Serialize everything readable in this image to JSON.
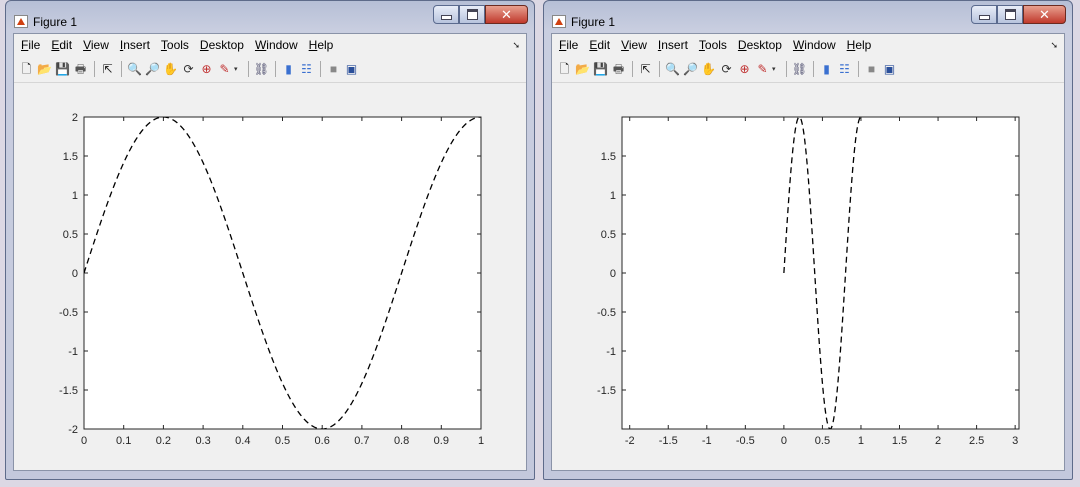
{
  "windows": [
    {
      "title": "Figure 1",
      "menu": [
        "File",
        "Edit",
        "View",
        "Insert",
        "Tools",
        "Desktop",
        "Window",
        "Help"
      ],
      "menu_accels": [
        "F",
        "E",
        "V",
        "I",
        "T",
        "D",
        "W",
        "H"
      ],
      "toolbar_icons": [
        "new-figure-icon",
        "open-file-icon",
        "save-icon",
        "print-icon",
        "|",
        "pointer-icon",
        "|",
        "zoom-in-icon",
        "zoom-out-icon",
        "pan-icon",
        "rotate-icon",
        "data-cursor-icon",
        "brush-icon",
        "brush-dropdown-icon",
        "|",
        "link-plot-icon",
        "|",
        "colorbar-icon",
        "legend-icon",
        "|",
        "hide-tools-icon",
        "show-tools-icon"
      ]
    },
    {
      "title": "Figure 1",
      "menu": [
        "File",
        "Edit",
        "View",
        "Insert",
        "Tools",
        "Desktop",
        "Window",
        "Help"
      ],
      "menu_accels": [
        "F",
        "E",
        "V",
        "I",
        "T",
        "D",
        "W",
        "H"
      ],
      "toolbar_icons": [
        "new-figure-icon",
        "open-file-icon",
        "save-icon",
        "print-icon",
        "|",
        "pointer-icon",
        "|",
        "zoom-in-icon",
        "zoom-out-icon",
        "pan-icon",
        "rotate-icon",
        "data-cursor-icon",
        "brush-icon",
        "brush-dropdown-icon",
        "|",
        "link-plot-icon",
        "|",
        "colorbar-icon",
        "legend-icon",
        "|",
        "hide-tools-icon",
        "show-tools-icon"
      ]
    }
  ],
  "chart_data": [
    {
      "type": "line",
      "series_style": "dashed",
      "line_color": "#000000",
      "function": "y = 2*sin(2.5*pi*x)",
      "x": [
        0,
        0.05,
        0.1,
        0.15,
        0.2,
        0.25,
        0.3,
        0.35,
        0.4,
        0.45,
        0.5,
        0.55,
        0.6,
        0.65,
        0.7,
        0.75,
        0.8,
        0.85,
        0.9,
        0.95,
        1.0
      ],
      "y": [
        0,
        0.765,
        1.414,
        1.848,
        2.0,
        1.848,
        1.414,
        0.765,
        0,
        -0.765,
        -1.414,
        -1.848,
        -2.0,
        -1.848,
        -1.414,
        -0.765,
        0,
        0.765,
        1.414,
        1.848,
        2.0
      ],
      "xlim": [
        0,
        1
      ],
      "ylim": [
        -2,
        2
      ],
      "xticks": [
        "0",
        "0.1",
        "0.2",
        "0.3",
        "0.4",
        "0.5",
        "0.6",
        "0.7",
        "0.8",
        "0.9",
        "1"
      ],
      "yticks": [
        "-2",
        "-1.5",
        "-1",
        "-0.5",
        "0",
        "0.5",
        "1",
        "1.5",
        "2"
      ],
      "xtick_values": [
        0,
        0.1,
        0.2,
        0.3,
        0.4,
        0.5,
        0.6,
        0.7,
        0.8,
        0.9,
        1
      ],
      "ytick_values": [
        -2,
        -1.5,
        -1,
        -0.5,
        0,
        0.5,
        1,
        1.5,
        2
      ],
      "title": "",
      "xlabel": "",
      "ylabel": "",
      "grid": false
    },
    {
      "type": "line",
      "series_style": "dashed",
      "line_color": "#000000",
      "function": "y = 2*sin(2.5*pi*x)",
      "x": [
        0,
        0.05,
        0.1,
        0.15,
        0.2,
        0.25,
        0.3,
        0.35,
        0.4,
        0.45,
        0.5,
        0.55,
        0.6,
        0.65,
        0.7,
        0.75,
        0.8,
        0.85,
        0.9,
        0.95,
        1.0
      ],
      "y": [
        0,
        0.765,
        1.414,
        1.848,
        2.0,
        1.848,
        1.414,
        0.765,
        0,
        -0.765,
        -1.414,
        -1.848,
        -2.0,
        -1.848,
        -1.414,
        -0.765,
        0,
        0.765,
        1.414,
        1.848,
        2.0
      ],
      "xlim": [
        -2.1,
        3.05
      ],
      "ylim": [
        -2,
        2
      ],
      "xticks": [
        "-2",
        "-1.5",
        "-1",
        "-0.5",
        "0",
        "0.5",
        "1",
        "1.5",
        "2",
        "2.5",
        "3"
      ],
      "yticks": [
        "-1.5",
        "-1",
        "-0.5",
        "0",
        "0.5",
        "1",
        "1.5"
      ],
      "xtick_values": [
        -2,
        -1.5,
        -1,
        -0.5,
        0,
        0.5,
        1,
        1.5,
        2,
        2.5,
        3
      ],
      "ytick_values": [
        -1.5,
        -1,
        -0.5,
        0,
        0.5,
        1,
        1.5
      ],
      "title": "",
      "xlabel": "",
      "ylabel": "",
      "grid": false
    }
  ]
}
